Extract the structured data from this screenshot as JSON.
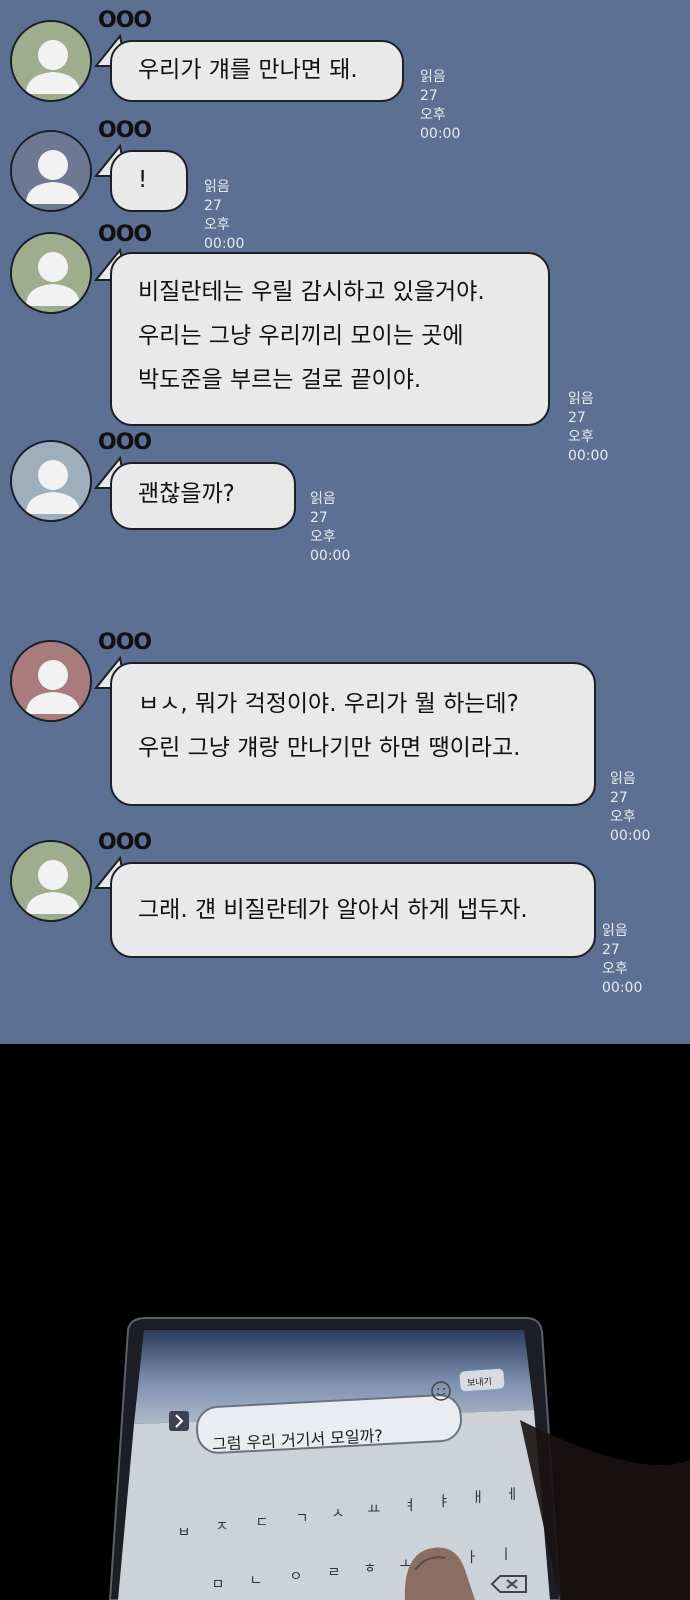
{
  "messages": [
    {
      "sender": "OOO",
      "text": "우리가 걔를 만나면 돼.",
      "read": "읽음27",
      "time": "오후00:00",
      "avatar_color": "#9eae8c"
    },
    {
      "sender": "OOO",
      "text": "!",
      "read": "읽음27",
      "time": "오후00:00",
      "avatar_color": "#6f7893"
    },
    {
      "sender": "OOO",
      "text": "비질란테는 우릴 감시하고 있을거야.\n우리는 그냥 우리끼리 모이는 곳에\n박도준을 부르는 걸로 끝이야.",
      "read": "읽음27",
      "time": "오후00:00",
      "avatar_color": "#9eae8c"
    },
    {
      "sender": "OOO",
      "text": "괜찮을까?",
      "read": "읽음27",
      "time": "오후00:00",
      "avatar_color": "#9daebd"
    },
    {
      "sender": "OOO",
      "text": "ㅂㅅ, 뭐가 걱정이야. 우리가 뭘 하는데?\n우린 그냥 걔랑 만나기만 하면 땡이라고.",
      "read": "읽음27",
      "time": "오후00:00",
      "avatar_color": "#a87c7c"
    },
    {
      "sender": "OOO",
      "text": "그래. 걘 비질란테가 알아서 하게 냅두자.",
      "read": "읽음27",
      "time": "오후00:00",
      "avatar_color": "#9eae8c"
    }
  ],
  "phone": {
    "input_value": "그럼 우리 거기서 모일까?",
    "send_label": "보내기",
    "keyboard_row1": [
      "ㅂ",
      "ㅈ",
      "ㄷ",
      "ㄱ",
      "ㅅ",
      "ㅛ",
      "ㅕ",
      "ㅑ",
      "ㅐ",
      "ㅔ"
    ],
    "keyboard_row2": [
      "ㅁ",
      "ㄴ",
      "ㅇ",
      "ㄹ",
      "ㅎ",
      "ㅗ",
      "ㅓ",
      "ㅏ",
      "ㅣ"
    ]
  },
  "colors": {
    "chat_background": "#5b7092",
    "bubble": "#e9e9ea",
    "page_background": "#000000"
  }
}
